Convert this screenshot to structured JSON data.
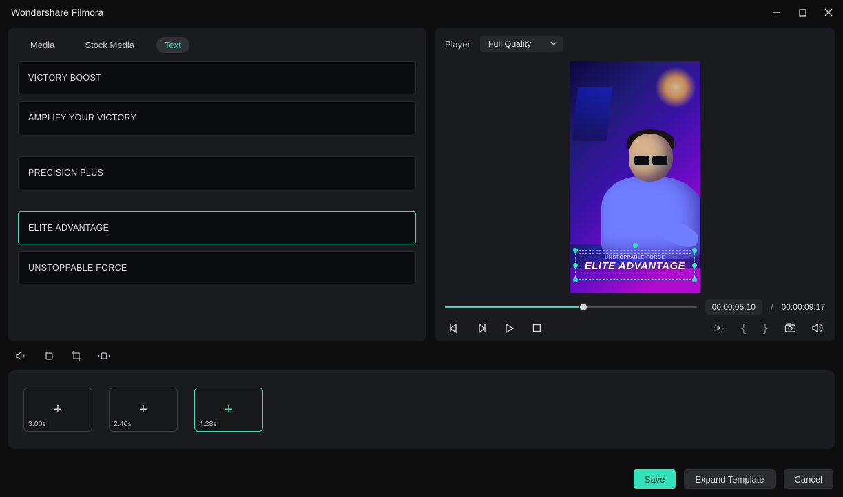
{
  "window": {
    "title": "Wondershare Filmora"
  },
  "tabs": {
    "media": "Media",
    "stock": "Stock Media",
    "text": "Text",
    "active": "text"
  },
  "textItems": {
    "t0": "VICTORY BOOST",
    "t1": "AMPLIFY YOUR VICTORY",
    "t2": "PRECISION PLUS",
    "t3": "ELITE ADVANTAGE",
    "t4": "UNSTOPPABLE FORCE"
  },
  "player": {
    "label": "Player",
    "quality": "Full Quality",
    "currentTime": "00:00:05:10",
    "separator": "/",
    "duration": "00:00:09:17",
    "progressPercent": 55,
    "overlay": {
      "sub": "UNSTOPPABLE FORCE",
      "main": "ELITE ADVANTAGE"
    }
  },
  "clips": {
    "c0": "3.00s",
    "c1": "2.40s",
    "c2": "4.28s"
  },
  "footer": {
    "save": "Save",
    "expand": "Expand Template",
    "cancel": "Cancel"
  }
}
